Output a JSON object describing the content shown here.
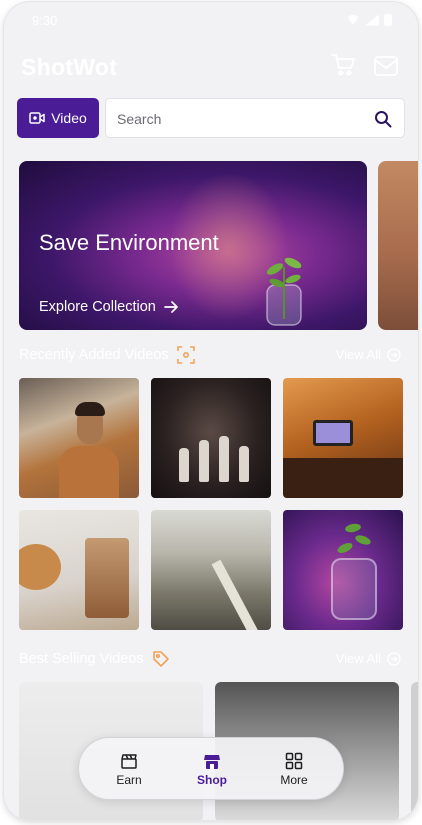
{
  "status_bar": {
    "time": "9:30"
  },
  "header": {
    "brand": "ShotWot",
    "icons": [
      "cart-icon",
      "mail-icon"
    ]
  },
  "toolbar": {
    "video_label": "Video"
  },
  "search": {
    "placeholder": "Search"
  },
  "banner": {
    "title": "Save Environment",
    "link_label": "Explore Collection"
  },
  "recently_added": {
    "title": "Recently Added Videos",
    "view_all": "View All",
    "thumbnails": [
      "man-with-mug",
      "chess-pieces",
      "laptop-desk",
      "tea-and-bread",
      "aerial-highway",
      "plant-jar-purple"
    ]
  },
  "best_selling": {
    "title": "Best Selling Videos",
    "view_all": "View All"
  },
  "bottom_nav": {
    "items": [
      {
        "label": "Earn",
        "icon": "clapperboard-icon"
      },
      {
        "label": "Shop",
        "icon": "shop-icon",
        "active": true
      },
      {
        "label": "More",
        "icon": "grid-icon"
      }
    ]
  },
  "colors": {
    "accent": "#4a1d96",
    "background": "#f2f2f4"
  }
}
